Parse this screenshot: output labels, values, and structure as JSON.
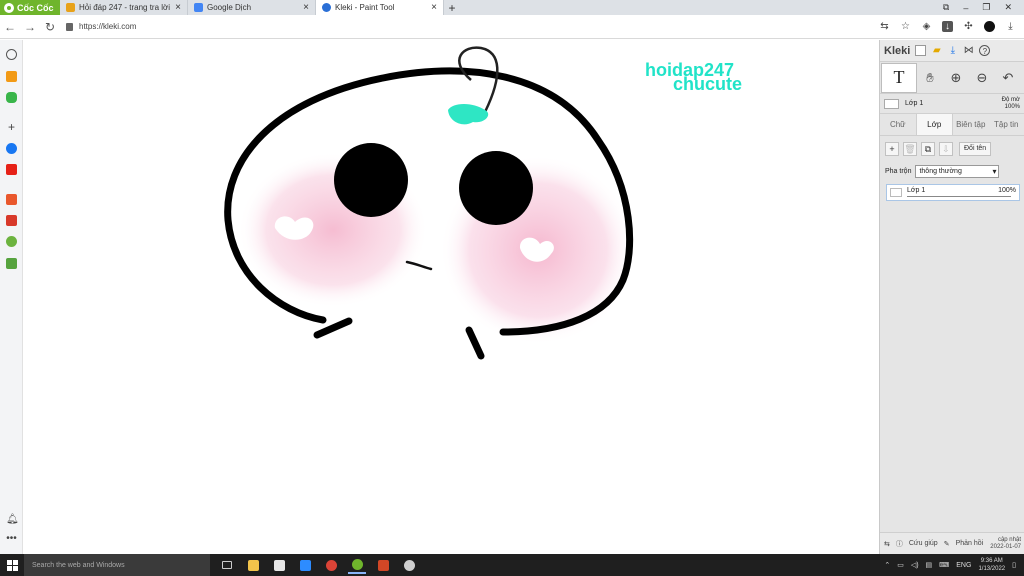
{
  "browser": {
    "brand": "Cốc Cốc",
    "tabs": [
      {
        "title": "Hỏi đáp 247 - trang tra lời",
        "favicon_color": "#e8a21a"
      },
      {
        "title": "Google Dịch",
        "favicon_color": "#4285f4"
      },
      {
        "title": "Kleki - Paint Tool",
        "favicon_color": "#2a6fd6",
        "active": true
      }
    ],
    "new_tab": "+",
    "url": "https://kleki.com"
  },
  "canvas": {
    "watermark_line1": "hoidap247",
    "watermark_line2": "chucute",
    "colors": {
      "stroke": "#000000",
      "blush": "#f7c6d9",
      "sprout": "#2ee6c4",
      "watermark": "#21e3c8"
    }
  },
  "kleki": {
    "logo": "Kleki",
    "layer_thumb_label": "Lớp 1",
    "opacity_label": "Độ mờ",
    "opacity_value": "100%",
    "tabs": [
      "Chữ",
      "Lớp",
      "Biên tập",
      "Tập tin"
    ],
    "active_tab": "Lớp",
    "rename_button": "Đổi tên",
    "blend_label": "Pha trộn",
    "blend_value": "thông thường",
    "layer_item_name": "Lớp 1",
    "layer_item_opacity": "100%",
    "help_label": "Cứu giúp",
    "feedback_label": "Phản hồi",
    "update_line1": "cập nhật",
    "update_line2": "2022-01-07"
  },
  "taskbar": {
    "search_placeholder": "Search the web and Windows",
    "language": "ENG",
    "time": "9:36 AM",
    "date": "1/13/2022"
  }
}
